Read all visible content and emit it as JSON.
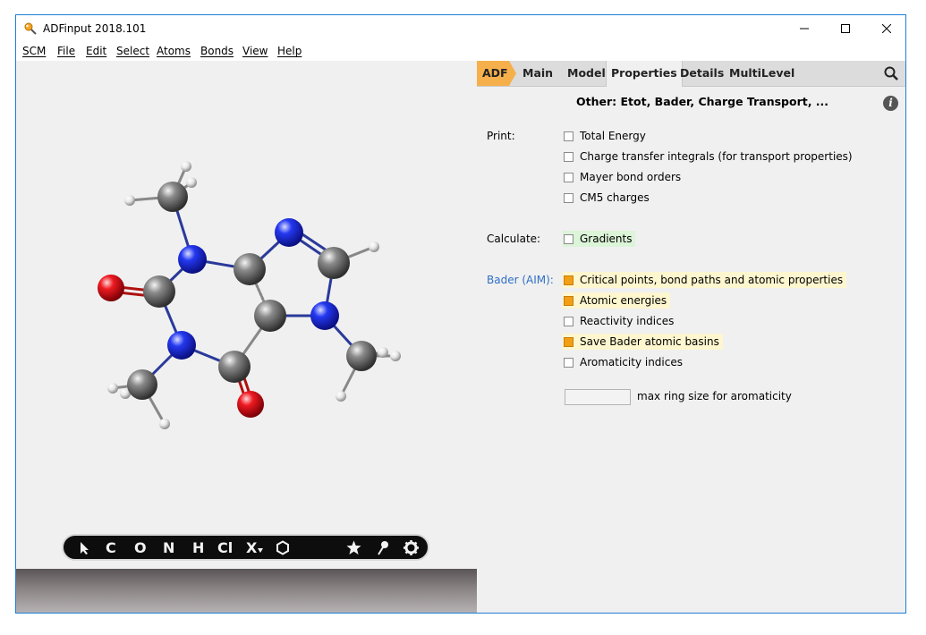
{
  "window": {
    "title": "ADFinput 2018.101"
  },
  "menu": [
    "SCM",
    "File",
    "Edit",
    "Select",
    "Atoms",
    "Bonds",
    "View",
    "Help"
  ],
  "tabs": [
    "ADF",
    "Main",
    "Model",
    "Properties",
    "Details",
    "MultiLevel"
  ],
  "active_tab": "Properties",
  "panel": {
    "heading": "Other: Etot, Bader, Charge Transport, ...",
    "print_label": "Print:",
    "print_options": [
      {
        "label": "Total Energy",
        "checked": false
      },
      {
        "label": "Charge transfer integrals (for transport properties)",
        "checked": false
      },
      {
        "label": "Mayer bond orders",
        "checked": false
      },
      {
        "label": "CM5 charges",
        "checked": false
      }
    ],
    "calculate_label": "Calculate:",
    "calculate_options": [
      {
        "label": "Gradients",
        "checked": false
      }
    ],
    "bader_label": "Bader (AIM):",
    "bader_options": [
      {
        "label": "Critical points, bond paths and atomic properties",
        "checked": true
      },
      {
        "label": "Atomic energies",
        "checked": true
      },
      {
        "label": "Reactivity indices",
        "checked": false
      },
      {
        "label": "Save Bader atomic basins",
        "checked": true
      },
      {
        "label": "Aromaticity indices",
        "checked": false
      }
    ],
    "ring_size_value": "",
    "ring_size_label": "max ring size for aromaticity"
  },
  "toolbar": {
    "tools": [
      "C",
      "O",
      "N",
      "H",
      "Cl",
      "X"
    ],
    "icons": [
      "select-arrow-icon",
      "ring-icon",
      "star-icon",
      "pin-icon",
      "gear-icon"
    ]
  },
  "colors": {
    "accent": "#f6b04b",
    "checked": "#f29f16",
    "highlight": "#fdf6cf",
    "link_blue": "#2f6fc6",
    "atom_carbon": "#5a5a5a",
    "atom_nitrogen": "#1c2be0",
    "atom_oxygen": "#e0141c",
    "atom_hydrogen": "#e8e8e8"
  }
}
